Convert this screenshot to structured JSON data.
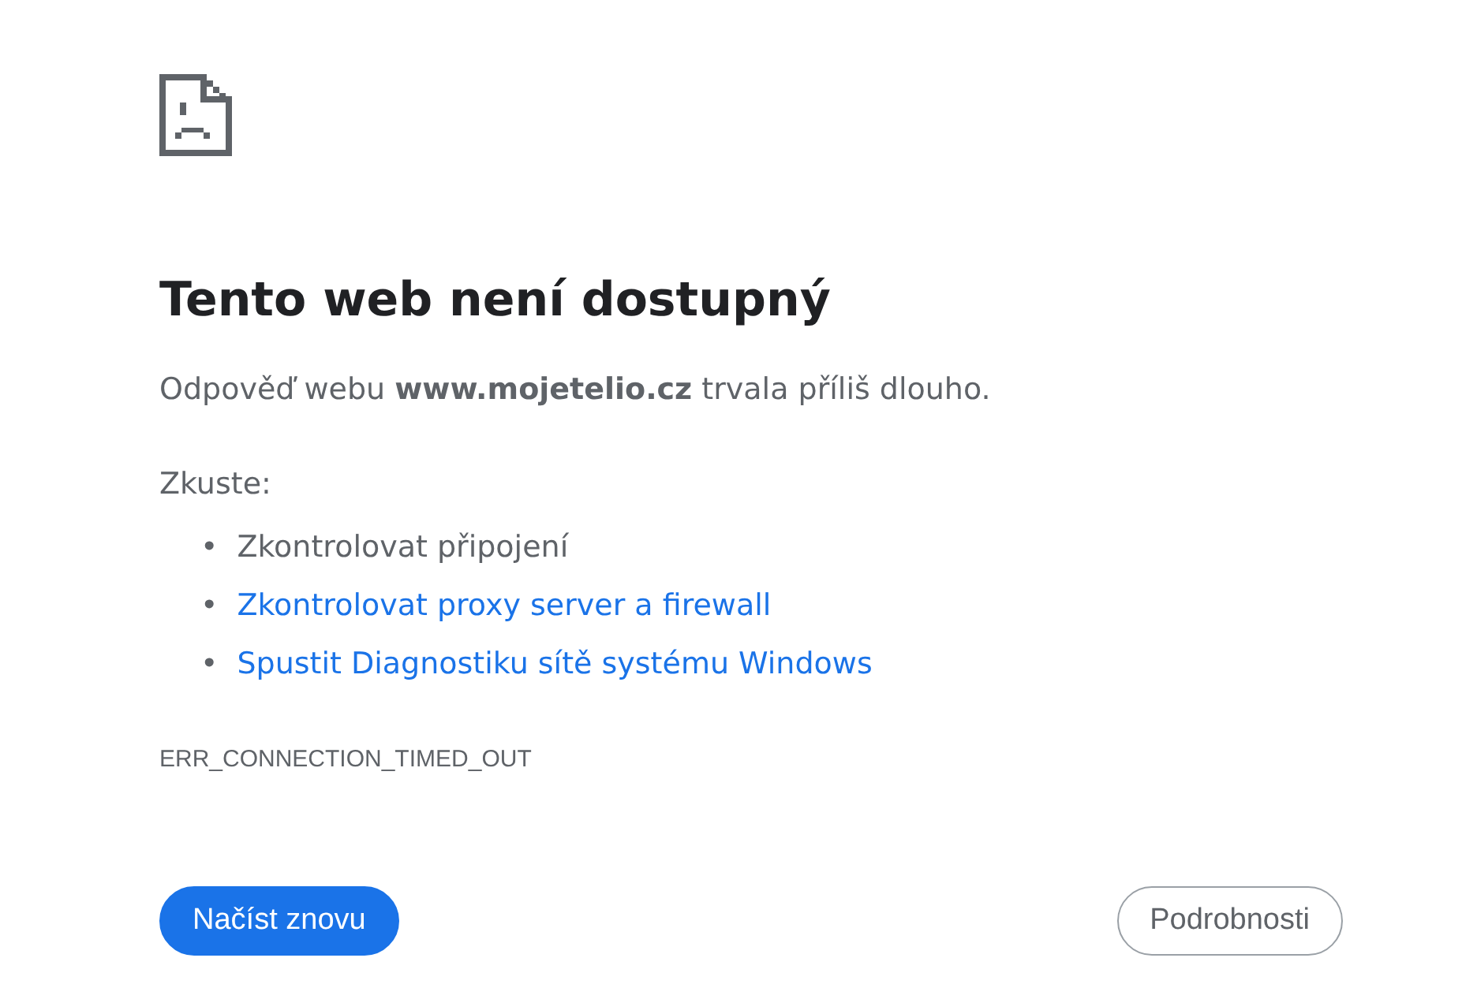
{
  "title": "Tento web není dostupný",
  "message": "Odpověď webu **www.mojetelio.cz** trvala příliš dlouho.",
  "suggestions_heading": "Zkuste:",
  "suggestions": [
    {
      "kind": "text",
      "bullet": "•",
      "label": "Zkontrolovat připojení"
    },
    {
      "kind": "link",
      "bullet": "•",
      "label": "Zkontrolovat proxy server a firewall"
    },
    {
      "kind": "link",
      "bullet": "•",
      "label": "Spustit Diagnostiku sítě systému Windows"
    }
  ],
  "error_code": "ERR_CONNECTION_TIMED_OUT",
  "buttons": [
    {
      "kind": "primary",
      "label": "Načíst znovu"
    },
    {
      "kind": "secondary",
      "label": "Podrobnosti"
    }
  ]
}
